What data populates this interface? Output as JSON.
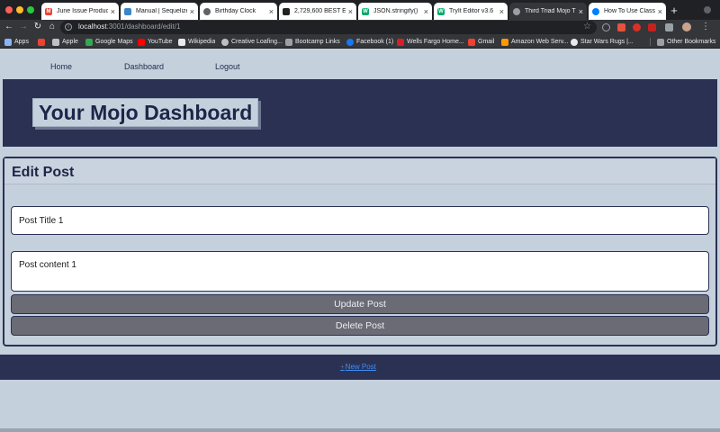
{
  "browser": {
    "tabs": [
      {
        "title": "June Issue Produc",
        "icon": "gmail-icon",
        "color": "#ea4335",
        "active": false
      },
      {
        "title": "Manual | Sequelize",
        "icon": "sequelize-icon",
        "color": "#3a86c8",
        "active": false
      },
      {
        "title": "Birthday Clock",
        "icon": "globe-icon",
        "color": "#5f6368",
        "active": false
      },
      {
        "title": "2,729,600 BEST E",
        "icon": "site-icon",
        "color": "#222222",
        "active": false
      },
      {
        "title": "JSON.stringify()",
        "icon": "w3schools-icon",
        "color": "#04aa6d",
        "active": false
      },
      {
        "title": "TryIt Editor v3.6",
        "icon": "w3schools-icon",
        "color": "#04aa6d",
        "active": false
      },
      {
        "title": "Third Triad Mojo T",
        "icon": "globe-icon",
        "color": "#9aa0a6",
        "active": true
      },
      {
        "title": "How To Use Classe",
        "icon": "digitalocean-icon",
        "color": "#0080ff",
        "active": false
      }
    ],
    "url_host": "localhost",
    "url_path": ":3001/dashboard/edit/1",
    "bookmarks": [
      {
        "label": "Apps",
        "color": "#8ab4f8"
      },
      {
        "label": "",
        "color": "#ea4335"
      },
      {
        "label": "Apple",
        "color": "#bdc1c6"
      },
      {
        "label": "Google Maps",
        "color": "#34a853"
      },
      {
        "label": "YouTube",
        "color": "#ff0000"
      },
      {
        "label": "Wikipedia",
        "color": "#e8eaed"
      },
      {
        "label": "Creative Loafing...",
        "color": "#bdc1c6"
      },
      {
        "label": "Bootcamp Links",
        "color": "#9aa0a6"
      },
      {
        "label": "Facebook (1)",
        "color": "#1877f2"
      },
      {
        "label": "Wells Fargo Home...",
        "color": "#d71e28"
      },
      {
        "label": "Gmail",
        "color": "#ea4335"
      },
      {
        "label": "Amazon Web Serv...",
        "color": "#ff9900"
      },
      {
        "label": "Star Wars Rugs |...",
        "color": "#e8eaed"
      },
      {
        "label": "Other Bookmarks",
        "color": "#9aa0a6"
      }
    ]
  },
  "nav": {
    "home": "Home",
    "dashboard": "Dashboard",
    "logout": "Logout"
  },
  "hero": {
    "title": "Your Mojo Dashboard"
  },
  "edit_post": {
    "heading": "Edit Post",
    "title_value": "Post Title 1",
    "content_value": "Post content 1",
    "update_label": "Update Post",
    "delete_label": "Delete Post"
  },
  "footer": {
    "new_post_label": "New Post"
  },
  "colors": {
    "page_bg": "#c5d0dd",
    "navy": "#2b3153",
    "button_gray": "#6a6b75",
    "link_blue": "#3f8ff5"
  }
}
